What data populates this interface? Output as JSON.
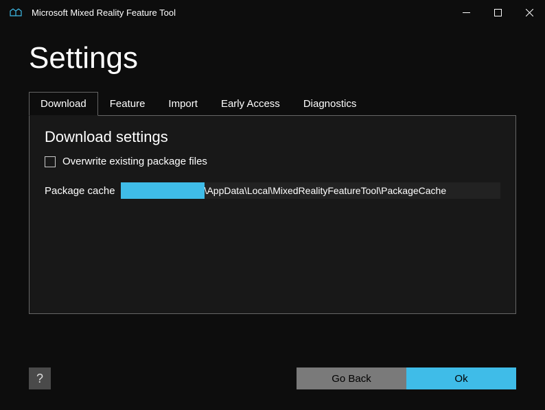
{
  "window": {
    "title": "Microsoft Mixed Reality Feature Tool"
  },
  "page": {
    "title": "Settings"
  },
  "tabs": {
    "download": "Download",
    "feature": "Feature",
    "import": "Import",
    "earlyAccess": "Early Access",
    "diagnostics": "Diagnostics"
  },
  "downloadSettings": {
    "title": "Download settings",
    "overwriteLabel": "Overwrite existing package files",
    "packageCacheLabel": "Package cache",
    "packageCachePath": "\\AppData\\Local\\MixedRealityFeatureTool\\PackageCache"
  },
  "footer": {
    "help": "?",
    "goBack": "Go Back",
    "ok": "Ok"
  }
}
